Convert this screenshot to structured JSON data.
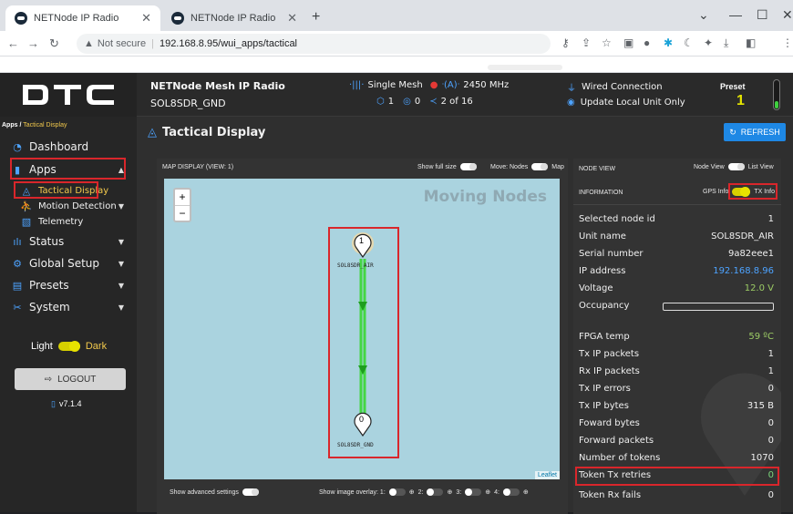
{
  "browser": {
    "tabs": [
      {
        "title": "NETNode IP Radio"
      },
      {
        "title": "NETNode IP Radio"
      }
    ],
    "address": {
      "warning": "Not secure",
      "url": "192.168.8.95/wui_apps/tactical"
    }
  },
  "header": {
    "logo": "DTC",
    "title": "NETNode Mesh IP Radio",
    "subtitle": "SOL8SDR_GND",
    "mesh": "Single Mesh",
    "freq": "2450 MHz",
    "count_a": "1",
    "count_b": "0",
    "count_c": "2 of 16",
    "connection": "Wired Connection",
    "update": "Update Local Unit Only",
    "preset_label": "Preset",
    "preset_value": "1"
  },
  "sidebar": {
    "breadcrumb_root": "Apps /",
    "breadcrumb_current": "Tactical Display",
    "items": [
      {
        "label": "Dashboard"
      },
      {
        "label": "Apps"
      },
      {
        "label": "Tactical Display"
      },
      {
        "label": "Motion Detection"
      },
      {
        "label": "Telemetry"
      },
      {
        "label": "Status"
      },
      {
        "label": "Global Setup"
      },
      {
        "label": "Presets"
      },
      {
        "label": "System"
      }
    ],
    "theme_light": "Light",
    "theme_dark": "Dark",
    "logout": "LOGOUT",
    "version": "v7.1.4"
  },
  "main": {
    "title": "Tactical Display",
    "refresh": "REFRESH"
  },
  "map": {
    "header": "MAP DISPLAY (VIEW: 1)",
    "show_full": "Show full size",
    "move": "Move: Nodes",
    "map_label": "Map",
    "moving": "Moving Nodes",
    "node_top_label": "SOL8SDR_AIR",
    "node_top_num": "1",
    "node_bottom_label": "SOL8SDR_GND",
    "node_bottom_num": "0",
    "leaflet": "Leaflet",
    "advanced": "Show advanced settings",
    "overlay": "Show image overlay: 1:",
    "ov2": "2:",
    "ov3": "3:",
    "ov4": "4:"
  },
  "node_view": {
    "header": "NODE VIEW",
    "toggle_left": "Node View",
    "toggle_right": "List View",
    "info": "INFORMATION",
    "gps": "GPS Info",
    "tx": "TX Info",
    "rows": [
      {
        "label": "Selected node id",
        "value": "1"
      },
      {
        "label": "Unit name",
        "value": "SOL8SDR_AIR"
      },
      {
        "label": "Serial number",
        "value": "9a82eee1"
      },
      {
        "label": "IP address",
        "value": "192.168.8.96"
      },
      {
        "label": "Voltage",
        "value": "12.0 V"
      },
      {
        "label": "Occupancy",
        "value": ""
      },
      {
        "label": "FPGA temp",
        "value": "59 ºC"
      },
      {
        "label": "Tx IP packets",
        "value": "1"
      },
      {
        "label": "Rx IP packets",
        "value": "1"
      },
      {
        "label": "Tx IP errors",
        "value": "0"
      },
      {
        "label": "Tx IP bytes",
        "value": "315 B"
      },
      {
        "label": "Foward bytes",
        "value": "0"
      },
      {
        "label": "Forward packets",
        "value": "0"
      },
      {
        "label": "Number of tokens",
        "value": "1070"
      },
      {
        "label": "Token Tx retries",
        "value": "0"
      },
      {
        "label": "Token Rx fails",
        "value": "0"
      }
    ]
  },
  "colors": {
    "accent": "#1e88e5",
    "highlight": "#d9262b",
    "link_line": "#44d644"
  }
}
